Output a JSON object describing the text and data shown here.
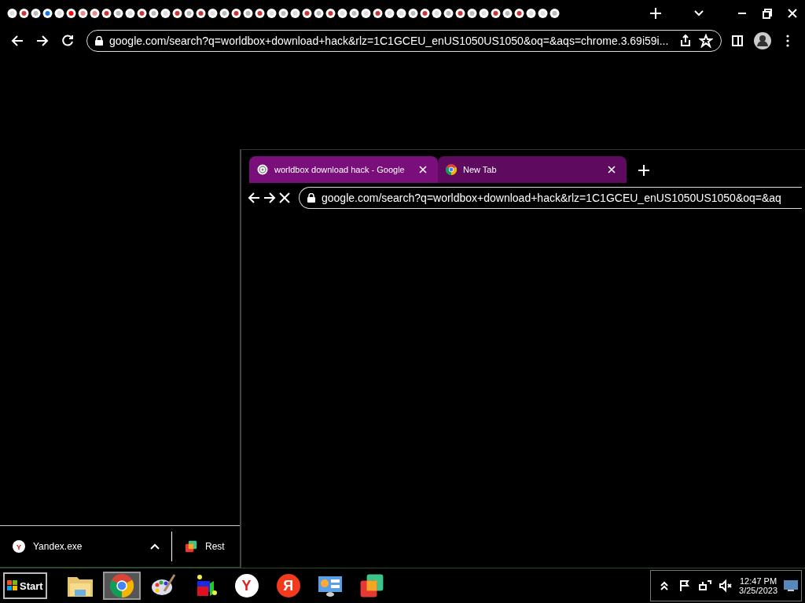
{
  "main_window": {
    "address": "google.com/search?q=worldbox+download+hack&rlz=1C1GCEU_enUS1050US1050&oq=&aqs=chrome.3.69i59i..."
  },
  "popup_window": {
    "tabs": [
      {
        "title": "worldbox download hack - Google",
        "selected": true,
        "kind": "search"
      },
      {
        "title": "New Tab",
        "selected": false,
        "kind": "chrome"
      }
    ],
    "address": "google.com/search?q=worldbox+download+hack&rlz=1C1GCEU_enUS1050US1050&oq=&aq",
    "loading": true
  },
  "downloads": [
    {
      "name": "Yandex.exe",
      "glyph": "Y",
      "kind": "yandex"
    },
    {
      "name": "Rest",
      "kind": "cube"
    }
  ],
  "taskbar": {
    "start": "Start",
    "apps": [
      {
        "kind": "folder",
        "selected": false
      },
      {
        "kind": "chrome",
        "selected": true
      },
      {
        "kind": "paint",
        "selected": false
      },
      {
        "kind": "cube3d",
        "selected": false
      },
      {
        "kind": "yandex",
        "glyph": "Y",
        "selected": false
      },
      {
        "kind": "yandex-red",
        "glyph": "Я",
        "selected": false
      },
      {
        "kind": "control",
        "selected": false
      },
      {
        "kind": "cube",
        "selected": false
      }
    ],
    "time": "12:47 PM",
    "date": "3/25/2023"
  }
}
